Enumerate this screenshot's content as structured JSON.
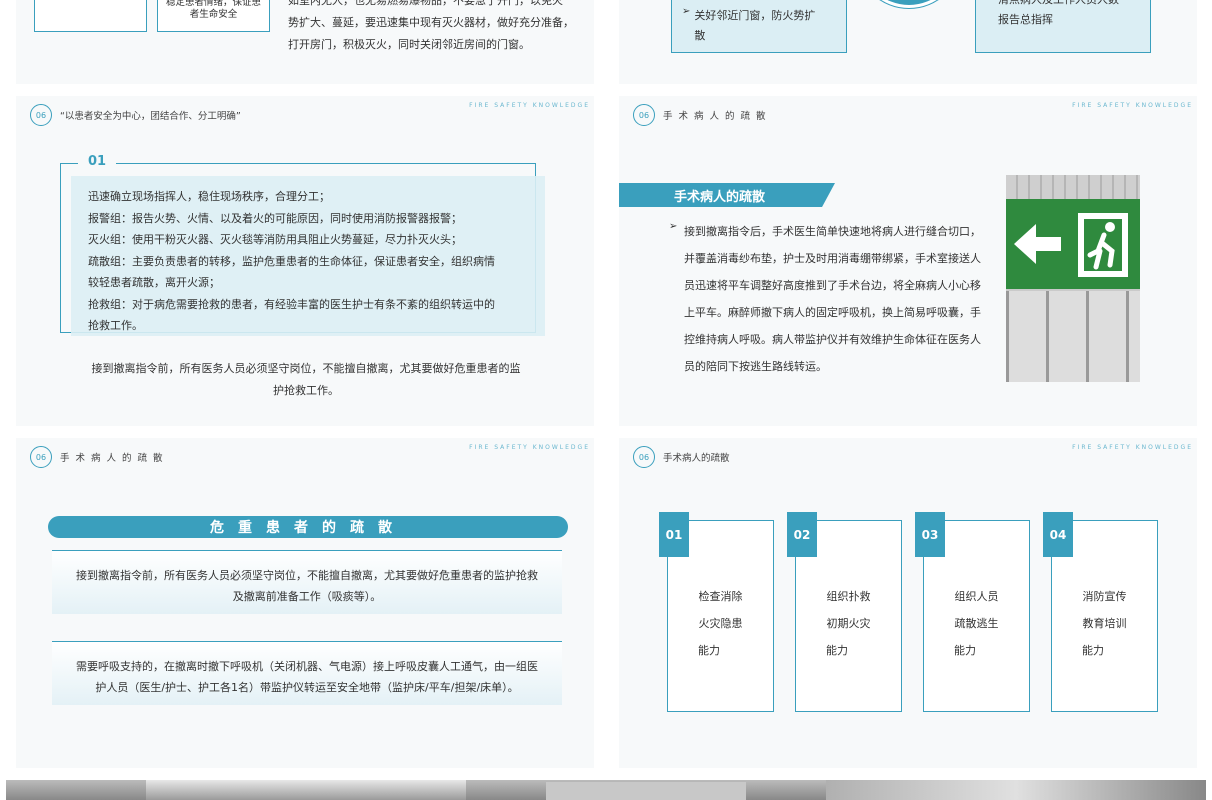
{
  "colors": {
    "accent": "#3a9fbd",
    "box_fill": "#dbeef4",
    "slide_bg": "#f7f9fa"
  },
  "top_left": {
    "box2_text": "稳定患者情绪，保证患者生命安全",
    "para_lines": [
      "如室内无人，也无易燃易爆物品，不要急于开门，以免火",
      "势扩大、蔓延，要迅速集中现有灭火器材，做好充分准备，",
      "打开房门，积极灭火，同时关闭邻近房间的门窗。"
    ]
  },
  "top_right": {
    "bullet": "关好邻近门窗，防火势扩散",
    "right_text": "清点病人及工作人员人数报告总指挥"
  },
  "fire_knowledge": "FIRE SAFETY KNOWLEDGE",
  "slide_a": {
    "num": "06",
    "title": "“以患者安全为中心，团结合作、分工明确”",
    "label": "01",
    "lines": [
      "迅速确立现场指挥人，稳住现场秩序，合理分工；",
      "报警组：报告火势、火情、以及着火的可能原因，同时使用消防报警器报警；",
      "灭火组：使用干粉灭火器、灭火毯等消防用具阻止火势蔓延，尽力扑灭火头；",
      "疏散组：主要负责患者的转移，监护危重患者的生命体征，保证患者安全，组织病情",
      "较轻患者疏散，离开火源；",
      "抢救组：对于病危需要抢救的患者，有经验丰富的医生护士有条不紊的组织转运中的",
      "抢救工作。"
    ],
    "note_lines": [
      "接到撤离指令前，所有医务人员必须坚守岗位，不能擅自撤离，尤其要做好危重患者的监",
      "护抢救工作。"
    ]
  },
  "slide_b": {
    "num": "06",
    "title": "手术病人的疏散",
    "banner": "手术病人的疏散",
    "para_lines": [
      "接到撤离指令后，手术医生简单快速地将病人进行缝合切口，",
      "并覆盖消毒纱布垫，护士及时用消毒绷带绑紧，手术室接送人",
      "员迅速将平车调整好高度推到了手术台边，将全麻病人小心移",
      "上平车。麻醉师撤下病人的固定呼吸机，换上简易呼吸囊，手",
      "控维持病人呼吸。病人带监护仪并有效维护生命体征在医务人",
      "员的陪同下按逃生路线转运。"
    ]
  },
  "slide_c": {
    "num": "06",
    "title": "手术病人的疏散",
    "banner": "危重患者的疏散",
    "para1_lines": [
      "接到撤离指令前，所有医务人员必须坚守岗位，不能擅自撤离，尤其要做好危重患者的监护抢救",
      "及撤离前准备工作（吸痰等）。"
    ],
    "para2_lines": [
      "需要呼吸支持的，在撤离时撤下呼吸机（关闭机器、气电源）接上呼吸皮囊人工通气，由一组医",
      "护人员（医生/护士、护工各1名）带监护仪转运至安全地带（监护床/平车/担架/床单）。"
    ]
  },
  "slide_d": {
    "num": "06",
    "title": "手术病人的疏散",
    "cards": [
      {
        "num": "01",
        "lines": [
          "检查消除",
          "火灾隐患",
          "能力"
        ]
      },
      {
        "num": "02",
        "lines": [
          "组织扑救",
          "初期火灾",
          "能力"
        ]
      },
      {
        "num": "03",
        "lines": [
          "组织人员",
          "疏散逃生",
          "能力"
        ]
      },
      {
        "num": "04",
        "lines": [
          "消防宣传",
          "教育培训",
          "能力"
        ]
      }
    ]
  }
}
